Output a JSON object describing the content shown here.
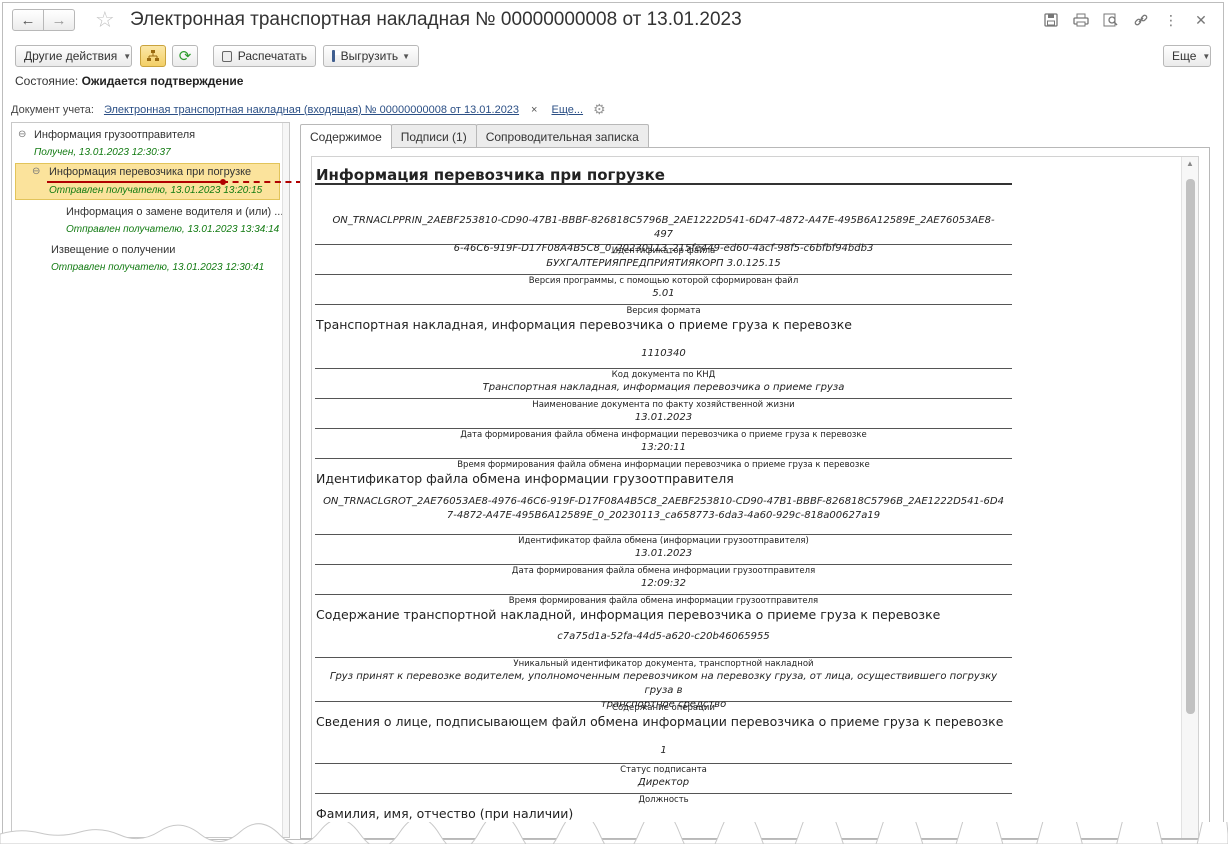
{
  "window": {
    "title": "Электронная транспортная накладная № 00000000008 от 13.01.2023"
  },
  "toolbar": {
    "more_actions": "Другие действия",
    "print": "Распечатать",
    "export": "Выгрузить",
    "more": "Еще"
  },
  "state": {
    "label": "Состояние:",
    "value": "Ожидается подтверждение"
  },
  "doc_account": {
    "label": "Документ учета:",
    "link": "Электронная транспортная накладная (входящая) № 00000000008 от 13.01.2023",
    "clear": "×",
    "more": "Еще..."
  },
  "tree": [
    {
      "title": "Информация грузоотправителя",
      "status": "Получен, 13.01.2023 12:30:37"
    },
    {
      "title": "Информация перевозчика при погрузке",
      "status": "Отправлен получателю, 13.01.2023 13:20:15"
    },
    {
      "title": "Информация о замене водителя и (или) ...",
      "status": "Отправлен получателю, 13.01.2023 13:34:14"
    },
    {
      "title": "Извещение о получении",
      "status": "Отправлен получателю, 13.01.2023 12:30:41"
    }
  ],
  "tabs": [
    {
      "label": "Содержимое"
    },
    {
      "label": "Подписи (1)"
    },
    {
      "label": "Сопроводительная записка"
    }
  ],
  "doc": {
    "heading": "Информация перевозчика при погрузке",
    "file_id": "ON_TRNACLPPRIN_2AEBF253810-CD90-47B1-BBBF-826818C5796B_2AE1222D541-6D47-4872-A47E-495B6A12589E_2AE76053AE8-4976-46C6-919F-D17F08A4B5C8_0_20230113_215fe449-ed60-4acf-98f5-c6bfbf94bdb3",
    "file_id_line1": "ON_TRNACLPPRIN_2AEBF253810-CD90-47B1-BBBF-826818C5796B_2AE1222D541-6D47-4872-A47E-495B6A12589E_2AE76053AE8-497",
    "file_id_line2": "6-46C6-919F-D17F08A4B5C8_0_20230113_215fe449-ed60-4acf-98f5-c6bfbf94bdb3",
    "file_id_key": "Идентификатор файла",
    "program": "БУХГАЛТЕРИЯПРЕДПРИЯТИЯКОРП 3.0.125.15",
    "program_key": "Версия программы, с помощью которой сформирован файл",
    "format": "5.01",
    "format_key": "Версия формата",
    "section1": "Транспортная накладная, информация перевозчика о приеме груза к перевозке",
    "knd": "1110340",
    "knd_key": "Код документа по КНД",
    "doc_name": "Транспортная накладная, информация перевозчика о приеме груза",
    "doc_name_key": "Наименование документа по факту хозяйственной жизни",
    "date": "13.01.2023",
    "date_key": "Дата формирования файла обмена информации перевозчика о приеме груза к перевозке",
    "time": "13:20:11",
    "time_key": "Время формирования файла обмена информации перевозчика о приеме груза к перевозке",
    "section2": "Идентификатор файла обмена информации грузоотправителя",
    "shipper_id_line1": "ON_TRNACLGROT_2AE76053AE8-4976-46C6-919F-D17F08A4B5C8_2AEBF253810-CD90-47B1-BBBF-826818C5796B_2AE1222D541-6D4",
    "shipper_id_line2": "7-4872-A47E-495B6A12589E_0_20230113_ca658773-6da3-4a60-929c-818a00627a19",
    "shipper_id_key": "Идентификатор файла обмена (информации грузоотправителя)",
    "shipper_date": "13.01.2023",
    "shipper_date_key": "Дата формирования файла обмена информации грузоотправителя",
    "shipper_time": "12:09:32",
    "shipper_time_key": "Время формирования файла обмена информации грузоотправителя",
    "section3": "Содержание транспортной накладной, информация перевозчика о приеме груза к перевозке",
    "uuid": "c7a75d1a-52fa-44d5-a620-c20b46065955",
    "uuid_key": "Уникальный идентификатор документа, транспортной накладной",
    "operation_line1": "Груз принят к перевозке водителем, уполномоченным перевозчиком на перевозку груза, от лица, осуществившего погрузку груза в",
    "operation_line2": "транспортное средство",
    "operation_key": "Содержание операции",
    "section4": "Сведения о лице, подписывающем файл обмена информации перевозчика о приеме груза к перевозке",
    "signer_status": "1",
    "signer_status_key": "Статус подписанта",
    "position": "Директор",
    "position_key": "Должность",
    "section5": "Фамилия, имя, отчество (при наличии)"
  }
}
